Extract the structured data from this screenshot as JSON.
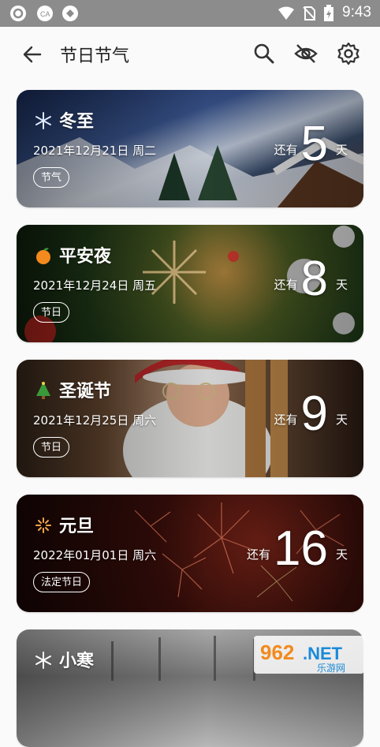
{
  "status_bar": {
    "time": "9:43"
  },
  "app_bar": {
    "title": "节日节气"
  },
  "cards": [
    {
      "icon": "snowflake-icon",
      "name": "冬至",
      "date": "2021年12月21日 周二",
      "tag": "节气",
      "prefix": "还有",
      "days": "5",
      "suffix": "天",
      "theme": "#2f4a7a"
    },
    {
      "icon": "tangerine-icon",
      "name": "平安夜",
      "date": "2021年12月24日 周五",
      "tag": "节日",
      "prefix": "还有",
      "days": "8",
      "suffix": "天",
      "theme": "#2e4a1f"
    },
    {
      "icon": "christmas-tree-icon",
      "name": "圣诞节",
      "date": "2021年12月25日 周六",
      "tag": "节日",
      "prefix": "还有",
      "days": "9",
      "suffix": "天",
      "theme": "#5a3a2a"
    },
    {
      "icon": "firework-icon",
      "name": "元旦",
      "date": "2022年01月01日 周六",
      "tag": "法定节日",
      "prefix": "还有",
      "days": "16",
      "suffix": "天",
      "theme": "#5a1410"
    },
    {
      "icon": "snowflake-icon",
      "name": "小寒",
      "date": "",
      "tag": "",
      "prefix": "",
      "days": "",
      "suffix": "",
      "theme": "#9a9a9a"
    }
  ],
  "watermark": {
    "line1": "962.NET",
    "line2": "乐游网"
  }
}
